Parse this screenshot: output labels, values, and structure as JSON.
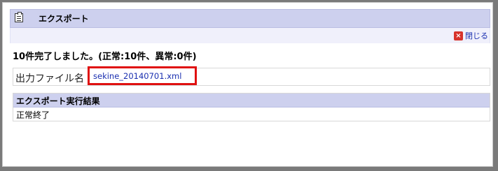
{
  "dialog": {
    "title": "エクスポート",
    "close_label": "閉じる"
  },
  "summary": "10件完了しました。(正常:10件、異常:0件)",
  "file": {
    "label": "出力ファイル名",
    "name": "sekine_20140701.xml"
  },
  "result": {
    "header": "エクスポート実行結果",
    "value": "正常終了"
  }
}
